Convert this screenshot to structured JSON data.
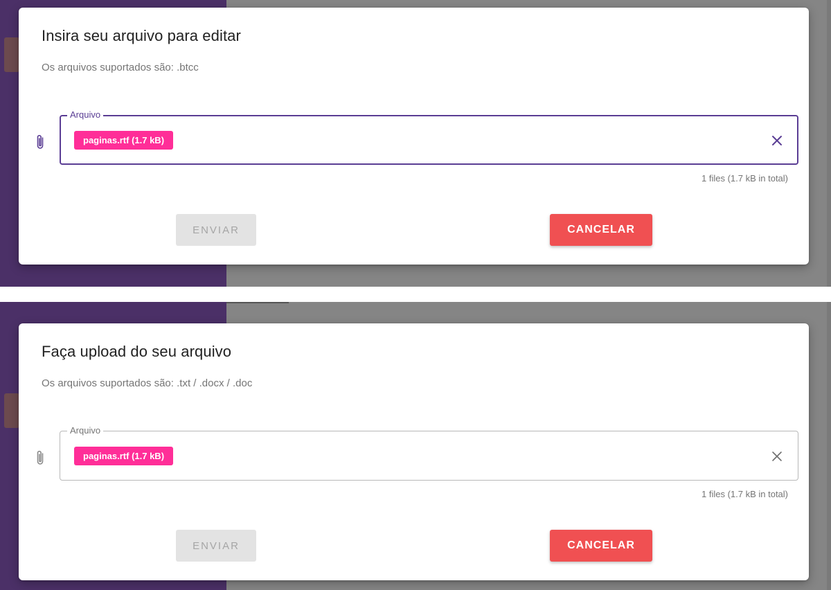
{
  "colors": {
    "accent_purple": "#5a3d94",
    "chip_pink": "#ff2e98",
    "cancel_red": "#f05052",
    "disabled_grey": "#e3e3e3"
  },
  "dialogs": [
    {
      "title": "Insira seu arquivo para editar",
      "subtitle": "Os arquivos suportados são: .btcc",
      "field_label": "Arquivo",
      "field_state": "focused",
      "file_chip": "paginas.rtf (1.7 kB)",
      "file_total": "1 files (1.7 kB in total)",
      "send_label": "ENVIAR",
      "send_disabled": true,
      "cancel_label": "CANCELAR",
      "icons": [
        "paperclip-icon",
        "close-icon"
      ]
    },
    {
      "title": "Faça upload do seu arquivo",
      "subtitle": "Os arquivos suportados são: .txt / .docx / .doc",
      "field_label": "Arquivo",
      "field_state": "default",
      "file_chip": "paginas.rtf (1.7 kB)",
      "file_total": "1 files (1.7 kB in total)",
      "send_label": "ENVIAR",
      "send_disabled": true,
      "cancel_label": "CANCELAR",
      "icons": [
        "paperclip-icon",
        "close-icon"
      ]
    }
  ]
}
